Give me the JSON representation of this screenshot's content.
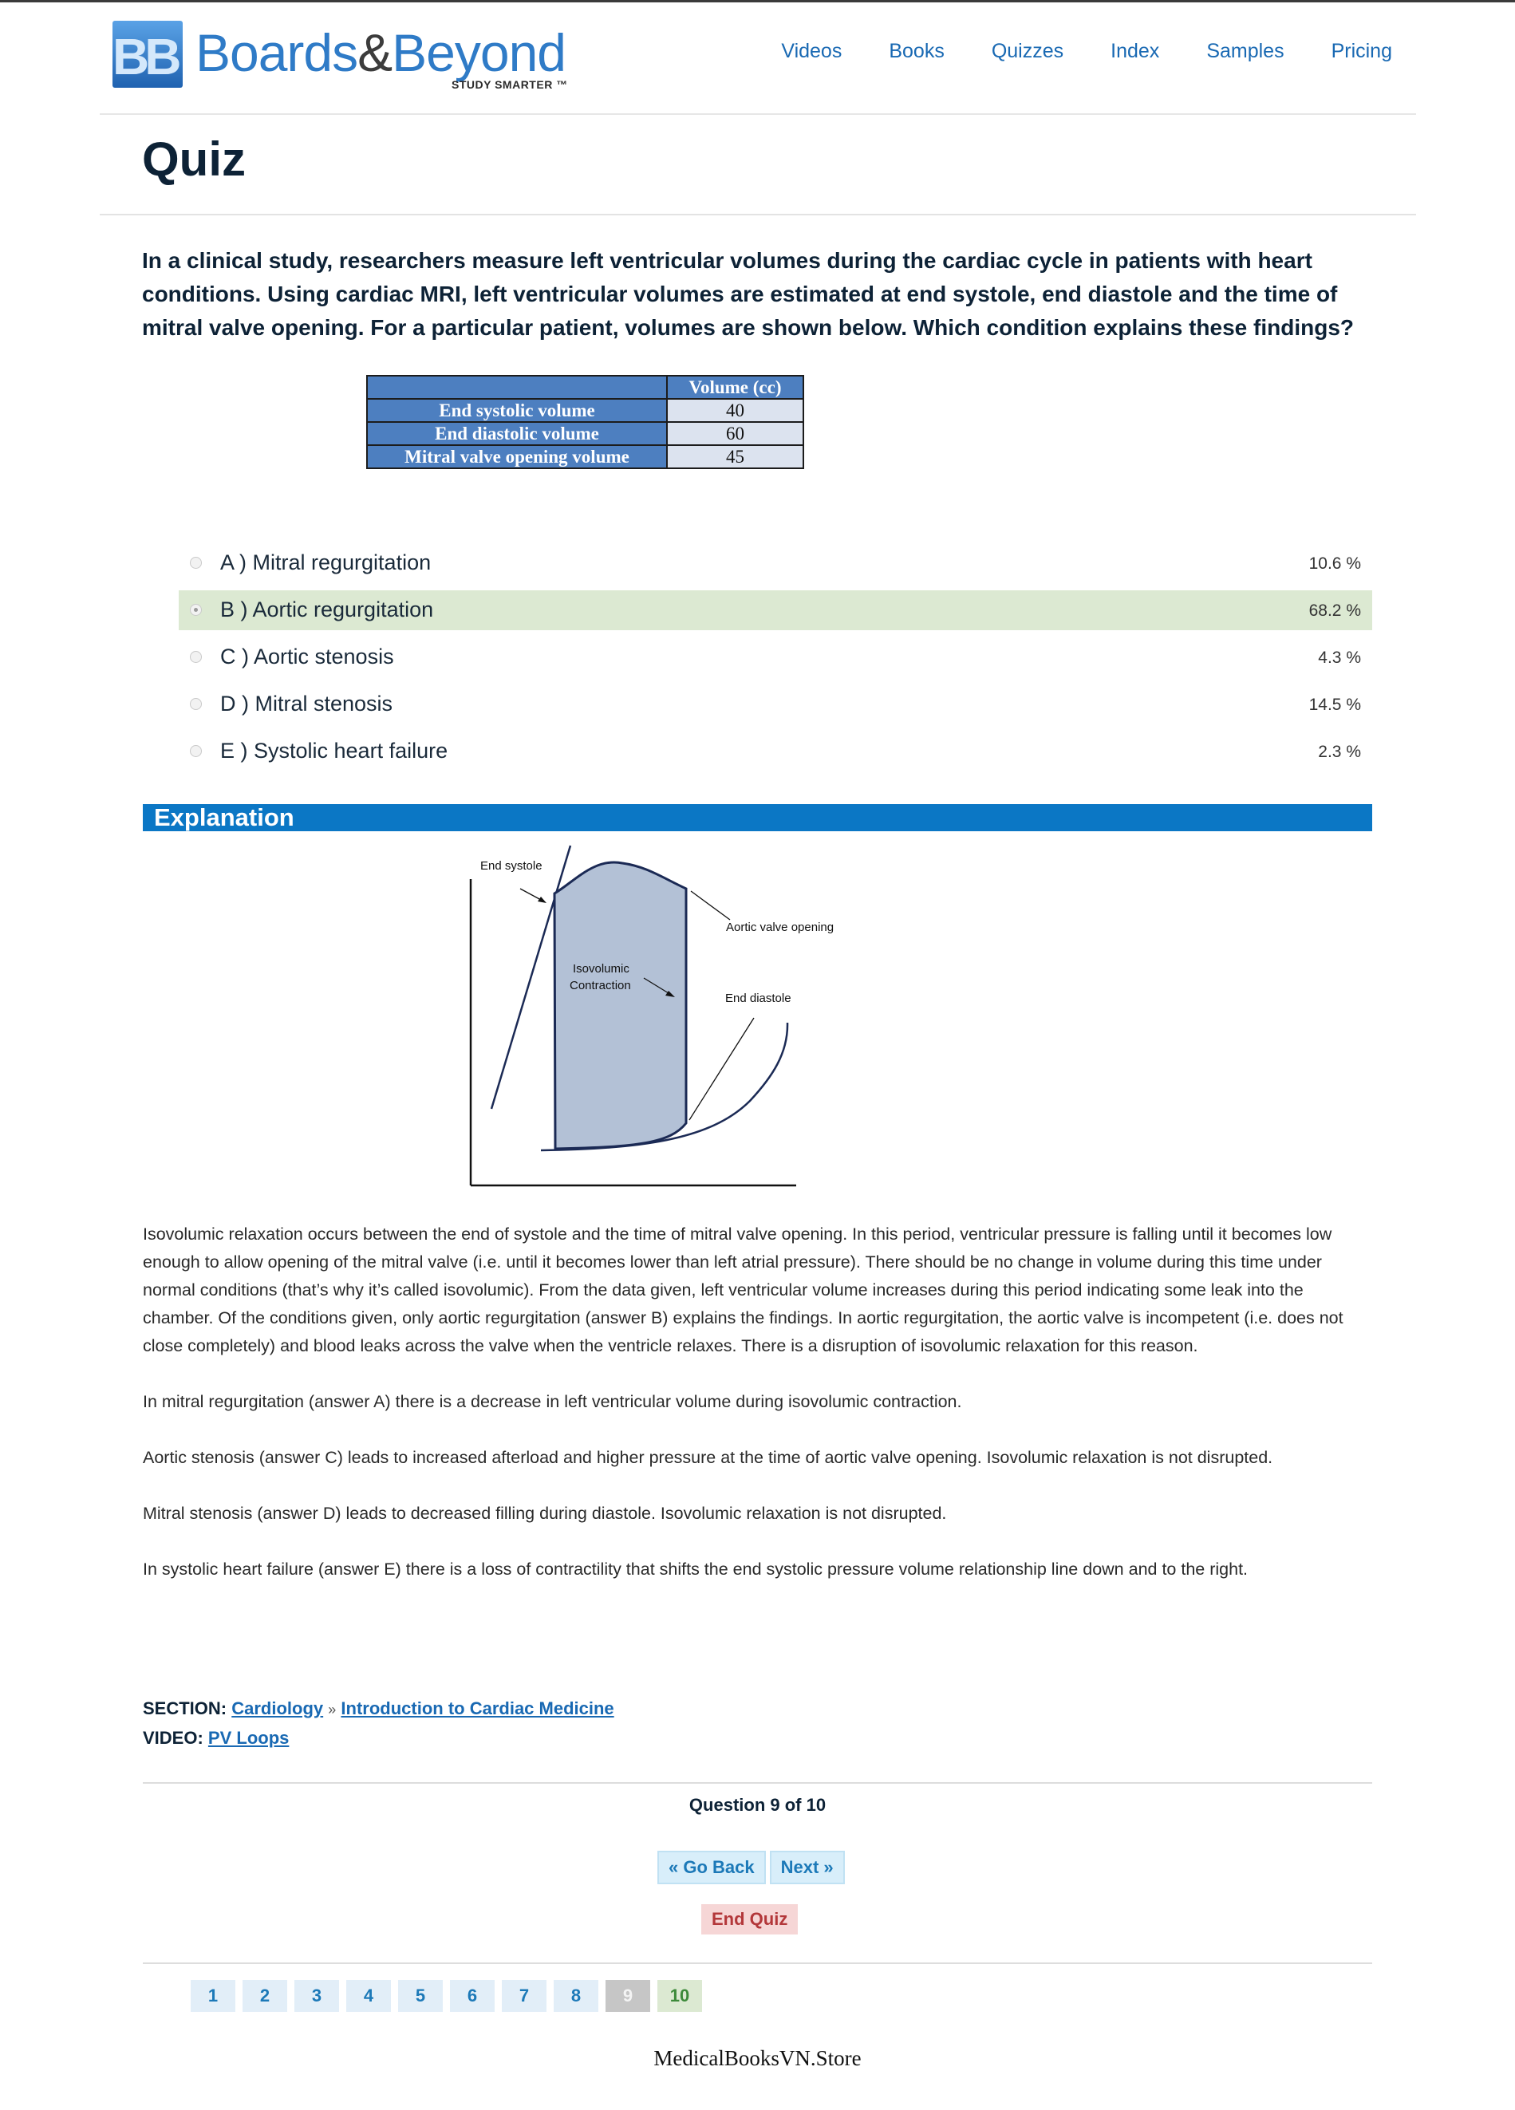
{
  "brand": {
    "logo_mark": "BB",
    "name_a": "Boards",
    "name_amp": "&",
    "name_b": "Beyond",
    "tagline": "STUDY SMARTER ™"
  },
  "nav": [
    "Videos",
    "Books",
    "Quizzes",
    "Index",
    "Samples",
    "Pricing"
  ],
  "page_title": "Quiz",
  "question": "In a clinical study, researchers measure left ventricular volumes during the cardiac cycle in patients with heart conditions. Using cardiac MRI, left ventricular volumes are estimated at end systole, end diastole and the time of mitral valve opening. For a particular patient, volumes are shown below. Which condition explains these findings?",
  "volume_table": {
    "value_header": "Volume (cc)",
    "rows": [
      {
        "label": "End systolic volume",
        "value": "40"
      },
      {
        "label": "End diastolic volume",
        "value": "60"
      },
      {
        "label": "Mitral valve opening volume",
        "value": "45"
      }
    ]
  },
  "answers": [
    {
      "label": "A ) Mitral regurgitation",
      "percent": "10.6 %",
      "selected": false
    },
    {
      "label": "B ) Aortic regurgitation",
      "percent": "68.2 %",
      "selected": true
    },
    {
      "label": "C ) Aortic stenosis",
      "percent": "4.3 %",
      "selected": false
    },
    {
      "label": "D ) Mitral stenosis",
      "percent": "14.5 %",
      "selected": false
    },
    {
      "label": "E ) Systolic heart failure",
      "percent": "2.3 %",
      "selected": false
    }
  ],
  "colors": {
    "accent_blue": "#0b77c5",
    "link_blue": "#1969b3",
    "correct_green": "#dce9d2",
    "end_quiz_red": "#b3373a",
    "loop_fill": "#b3c1d6",
    "loop_stroke": "#1b2a55"
  },
  "explanation": {
    "heading": "Explanation",
    "diagram_labels": {
      "end_systole": "End systole",
      "aortic_valve_opening": "Aortic valve opening",
      "isovolumic_1": "Isovolumic",
      "isovolumic_2": "Contraction",
      "end_diastole": "End diastole"
    },
    "paragraphs": [
      "Isovolumic relaxation occurs between the end of systole and the time of mitral valve opening. In this period, ventricular pressure is falling until it becomes low enough to allow opening of the mitral valve (i.e. until it becomes lower than left atrial pressure). There should be no change in volume during this time under normal conditions (that’s why it’s called isovolumic). From the data given, left ventricular volume increases during this period indicating some leak into the chamber. Of the conditions given, only aortic regurgitation (answer B) explains the findings. In aortic regurgitation, the aortic valve is incompetent (i.e. does not close completely) and blood leaks across the valve when the ventricle relaxes. There is a disruption of isovolumic relaxation for this reason.",
      "In mitral regurgitation (answer A) there is a decrease in left ventricular volume during isovolumic contraction.",
      "Aortic stenosis (answer C) leads to increased afterload and higher pressure at the time of aortic valve opening. Isovolumic relaxation is not disrupted.",
      "Mitral stenosis (answer D) leads to decreased filling during diastole. Isovolumic relaxation is not disrupted.",
      "In systolic heart failure (answer E) there is a loss of contractility that shifts the end systolic pressure volume relationship line down and to the right."
    ]
  },
  "section": {
    "section_label": "SECTION:",
    "section_link": "Cardiology",
    "separator": "»",
    "subsection_link": "Introduction to Cardiac Medicine",
    "video_label": "VIDEO:",
    "video_link": "PV Loops"
  },
  "quiz_nav": {
    "progress": "Question 9 of 10",
    "back_label": "« Go Back",
    "next_label": "Next »",
    "end_label": "End Quiz",
    "pages": [
      "1",
      "2",
      "3",
      "4",
      "5",
      "6",
      "7",
      "8",
      "9",
      "10"
    ],
    "current_page": "9"
  },
  "watermark": "MedicalBooksVN.Store"
}
